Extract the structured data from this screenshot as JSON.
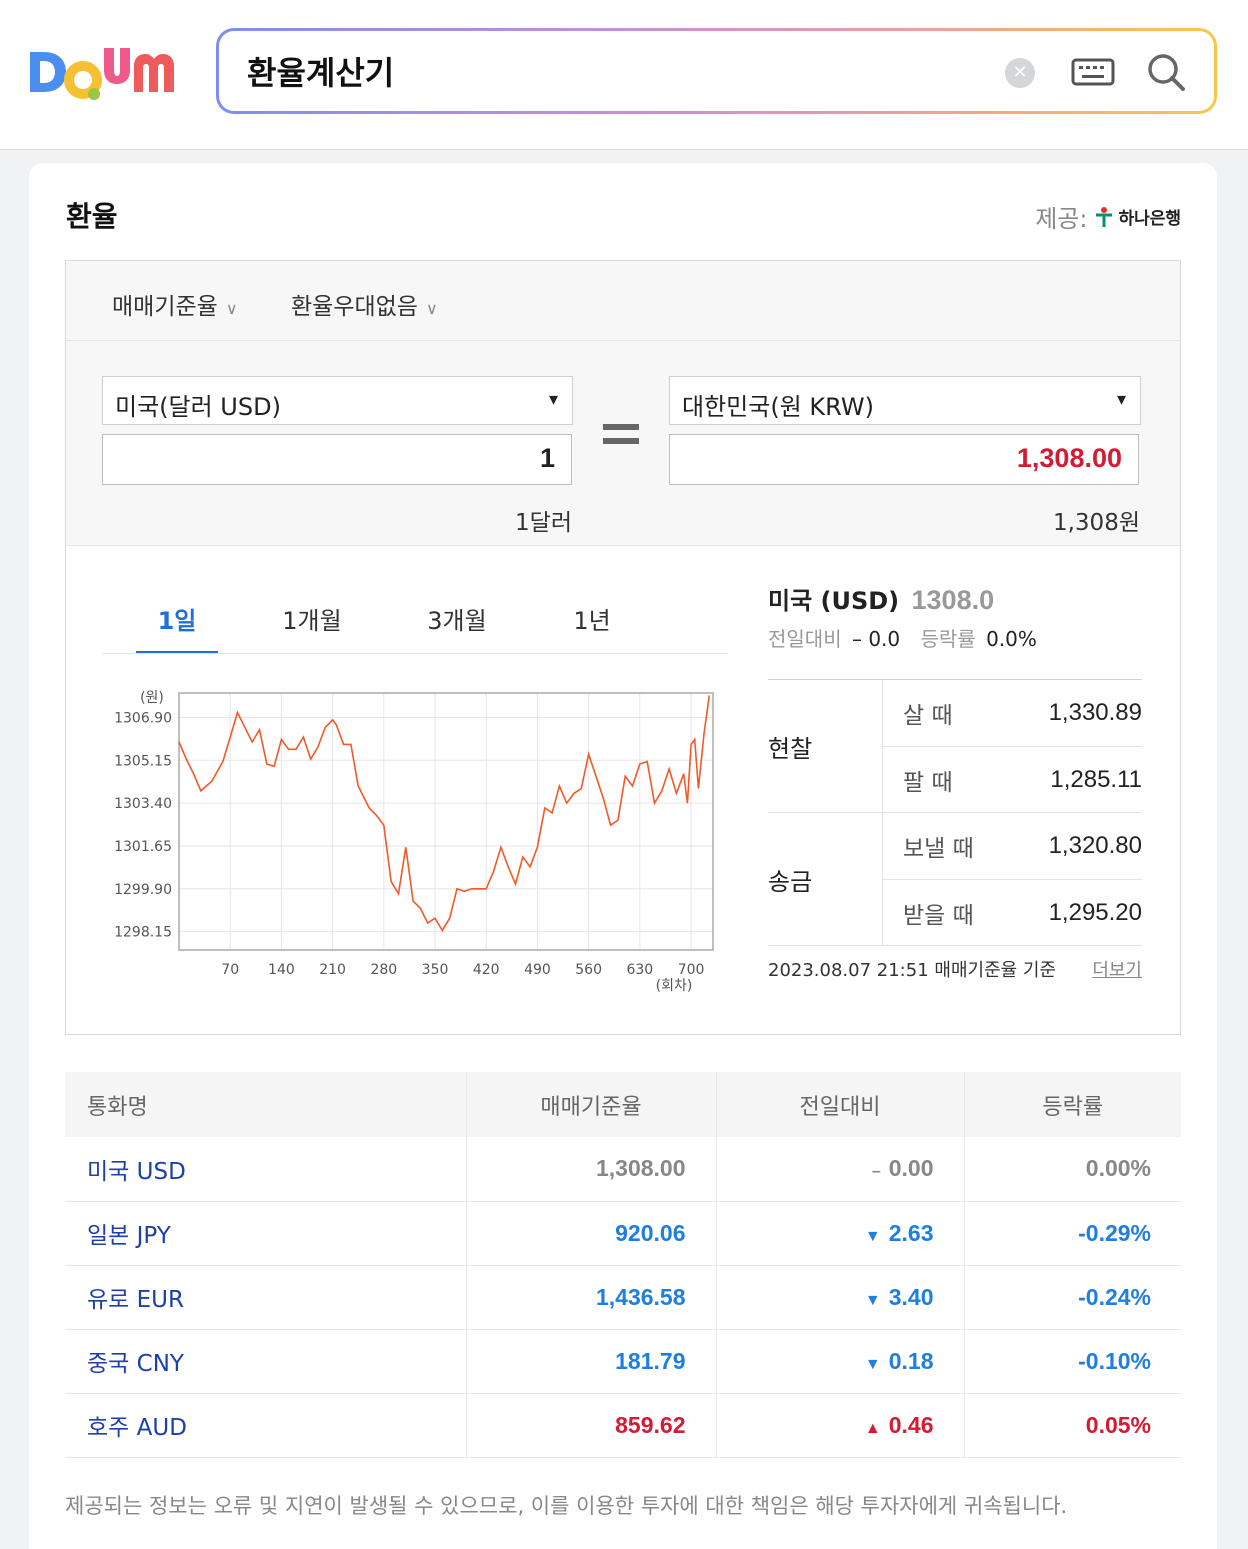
{
  "search": {
    "query": "환율계산기"
  },
  "card": {
    "title": "환율",
    "provider_label": "제공:",
    "provider_name": "하나은행"
  },
  "options": {
    "rate_type": "매매기준율",
    "discount": "환율우대없음"
  },
  "converter": {
    "from_currency": "미국(달러 USD)",
    "from_amount": "1",
    "from_text": "1달러",
    "to_currency": "대한민국(원 KRW)",
    "to_amount": "1,308.00",
    "to_text": "1,308원"
  },
  "chart_tabs": [
    "1일",
    "1개월",
    "3개월",
    "1년"
  ],
  "chart_data": {
    "type": "line",
    "ylabel": "(원)",
    "xlabel": "(회차)",
    "yticks": [
      "1306.90",
      "1305.15",
      "1303.40",
      "1301.65",
      "1299.90",
      "1298.15"
    ],
    "xticks": [
      "70",
      "140",
      "210",
      "280",
      "350",
      "420",
      "490",
      "560",
      "630",
      "700"
    ],
    "ylim": [
      1297.4,
      1307.9
    ],
    "xlim": [
      0,
      730
    ],
    "color": "#f05a28",
    "series": [
      {
        "x": [
          0,
          10,
          20,
          30,
          45,
          60,
          70,
          80,
          90,
          100,
          110,
          120,
          130,
          140,
          150,
          160,
          170,
          180,
          190,
          200,
          210,
          215,
          225,
          235,
          245,
          260,
          270,
          280,
          290,
          300,
          310,
          320,
          330,
          340,
          350,
          360,
          370,
          380,
          390,
          400,
          410,
          420,
          430,
          440,
          450,
          460,
          470,
          480,
          490,
          500,
          510,
          520,
          530,
          540,
          550,
          560,
          570,
          580,
          590,
          600,
          610,
          620,
          630,
          640,
          650,
          660,
          670,
          680,
          690,
          695,
          700,
          705,
          710,
          718,
          725
        ],
        "y": [
          1305.9,
          1305.2,
          1304.6,
          1303.9,
          1304.3,
          1305.1,
          1306.1,
          1307.1,
          1306.5,
          1305.9,
          1306.4,
          1305.0,
          1304.9,
          1306.0,
          1305.6,
          1305.6,
          1306.1,
          1305.2,
          1305.7,
          1306.5,
          1306.8,
          1306.6,
          1305.8,
          1305.8,
          1304.1,
          1303.2,
          1302.9,
          1302.5,
          1300.2,
          1299.7,
          1301.6,
          1299.4,
          1299.1,
          1298.5,
          1298.7,
          1298.2,
          1298.7,
          1299.9,
          1299.8,
          1299.9,
          1299.9,
          1299.9,
          1300.6,
          1301.6,
          1300.8,
          1300.1,
          1301.2,
          1300.8,
          1301.6,
          1303.2,
          1303.0,
          1304.1,
          1303.4,
          1303.8,
          1304.0,
          1305.4,
          1304.5,
          1303.6,
          1302.5,
          1302.7,
          1304.5,
          1304.1,
          1305.0,
          1305.1,
          1303.4,
          1303.9,
          1304.8,
          1303.8,
          1304.6,
          1303.4,
          1305.8,
          1306.0,
          1304.0,
          1306.3,
          1307.8
        ]
      }
    ]
  },
  "info": {
    "title": "미국 (USD)",
    "price": "1308.0",
    "change_label": "전일대비",
    "change_value": "0.0",
    "rate_label": "등락률",
    "rate_value": "0.0%",
    "cash_label": "현찰",
    "cash_buy_label": "살 때",
    "cash_buy": "1,330.89",
    "cash_sell_label": "팔 때",
    "cash_sell": "1,285.11",
    "remit_label": "송금",
    "remit_send_label": "보낼 때",
    "remit_send": "1,320.80",
    "remit_recv_label": "받을 때",
    "remit_recv": "1,295.20",
    "timestamp": "2023.08.07 21:51",
    "basis": "매매기준율 기준",
    "more": "더보기"
  },
  "table": {
    "headers": [
      "통화명",
      "매매기준율",
      "전일대비",
      "등락률"
    ],
    "rows": [
      {
        "name": "미국 USD",
        "rate": "1,308.00",
        "change": "0.00",
        "pct": "0.00%",
        "dir": "flat"
      },
      {
        "name": "일본 JPY",
        "rate": "920.06",
        "change": "2.63",
        "pct": "-0.29%",
        "dir": "down"
      },
      {
        "name": "유로 EUR",
        "rate": "1,436.58",
        "change": "3.40",
        "pct": "-0.24%",
        "dir": "down"
      },
      {
        "name": "중국 CNY",
        "rate": "181.79",
        "change": "0.18",
        "pct": "-0.10%",
        "dir": "down"
      },
      {
        "name": "호주 AUD",
        "rate": "859.62",
        "change": "0.46",
        "pct": "0.05%",
        "dir": "up"
      }
    ]
  },
  "disclaimer": "제공되는 정보는 오류 및 지연이 발생될 수 있으므로, 이를 이용한 투자에 대한 책임은 해당 투자자에게 귀속됩니다."
}
